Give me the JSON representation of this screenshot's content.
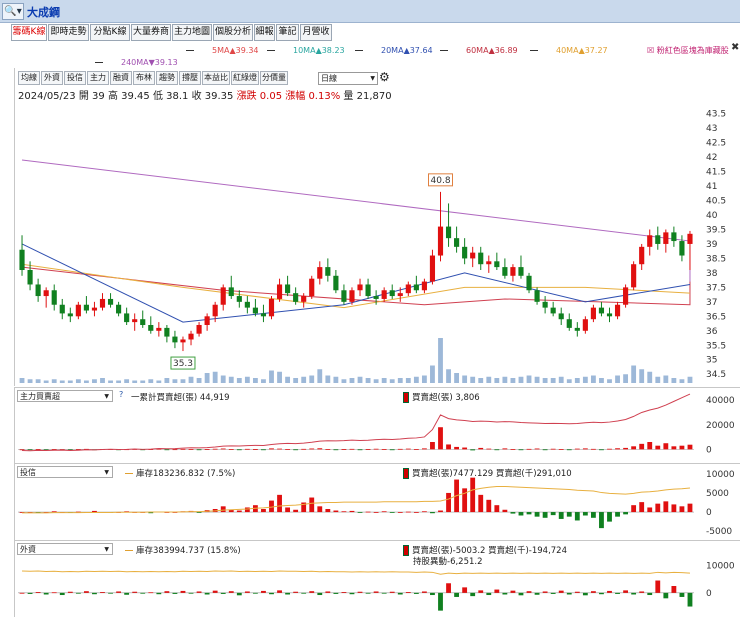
{
  "window": {
    "title": "大成鋼",
    "tool_icon": "magnifier-icon"
  },
  "tabs": [
    "籌碼K線",
    "即時走勢",
    "分點K線",
    "大量券商",
    "主力地圖",
    "個股分析",
    "細報",
    "筆記",
    "月營收"
  ],
  "active_tab": 0,
  "ma_legend": [
    {
      "label": "5MA",
      "value": "▲39.34",
      "color": "#e04848"
    },
    {
      "label": "10MA",
      "value": "▲38.23",
      "color": "#2aa6a0"
    },
    {
      "label": "20MA",
      "value": "▲37.64",
      "color": "#3050b0"
    },
    {
      "label": "60MA",
      "value": "▲36.89",
      "color": "#c03040"
    },
    {
      "label": "40MA",
      "value": "▲37.27",
      "color": "#e0a030"
    },
    {
      "label": "240MA",
      "value": "▼39.13",
      "color": "#a050b0"
    }
  ],
  "note": "粉紅色區塊為庫藏股",
  "toolbar": [
    "均線",
    "外資",
    "投信",
    "主力",
    "融資",
    "布林",
    "趨勢",
    "撐壓",
    "本益比",
    "紅綠燈",
    "分價量"
  ],
  "period": "日線",
  "info": {
    "date": "2024/05/23",
    "open_label": "開",
    "open": "39",
    "high_label": "高",
    "high": "39.45",
    "low_label": "低",
    "low": "38.1",
    "close_label": "收",
    "close": "39.35",
    "change_label": "漲跌",
    "change": "0.05",
    "pct_label": "漲幅",
    "pct": "0.13%",
    "vol_label": "量",
    "vol": "21,870"
  },
  "price_axis": [
    "43.5",
    "43",
    "42.5",
    "42",
    "41.5",
    "41",
    "40.5",
    "40",
    "39.5",
    "39",
    "38.5",
    "38",
    "37.5",
    "37",
    "36.5",
    "36",
    "35.5",
    "35",
    "34.5"
  ],
  "price_marks": {
    "high": "40.8",
    "low": "35.3"
  },
  "panels": [
    {
      "select": "主力買賣超",
      "legend1": "一累計買賣超(張) 44,919",
      "legend2": "買賣超(張) 3,806",
      "axis": [
        "40000",
        "20000",
        "0"
      ]
    },
    {
      "select": "投信",
      "legend1": "庫存183236.832 (7.5%)",
      "legend2": "買賣超(張)7477.129 買賣超(千)291,010",
      "axis": [
        "10000",
        "5000",
        "0",
        "-5000"
      ]
    },
    {
      "select": "外資",
      "legend1": "庫存383994.737 (15.8%)",
      "legend2": "買賣超(張)-5003.2 買賣超(千)-194,724",
      "legend3": "持股異動-6,251.2",
      "axis": [
        "10000",
        "0"
      ]
    }
  ],
  "chart_data": {
    "type": "candlestick",
    "price_range": [
      34.3,
      43.8
    ],
    "candles": [
      [
        38.8,
        39.3,
        37.9,
        38.1
      ],
      [
        38.1,
        38.4,
        37.4,
        37.6
      ],
      [
        37.6,
        37.8,
        37.0,
        37.2
      ],
      [
        37.2,
        37.5,
        36.8,
        37.4
      ],
      [
        37.4,
        37.6,
        36.7,
        36.9
      ],
      [
        36.9,
        37.1,
        36.4,
        36.6
      ],
      [
        36.6,
        36.8,
        36.3,
        36.5
      ],
      [
        36.5,
        37.0,
        36.4,
        36.9
      ],
      [
        36.9,
        37.2,
        36.6,
        36.7
      ],
      [
        36.7,
        37.0,
        36.5,
        36.8
      ],
      [
        36.8,
        37.3,
        36.7,
        37.1
      ],
      [
        37.1,
        37.3,
        36.8,
        36.9
      ],
      [
        36.9,
        37.0,
        36.5,
        36.6
      ],
      [
        36.6,
        36.8,
        36.2,
        36.3
      ],
      [
        36.3,
        36.6,
        36.0,
        36.4
      ],
      [
        36.4,
        36.7,
        36.1,
        36.2
      ],
      [
        36.2,
        36.5,
        35.9,
        36.0
      ],
      [
        36.0,
        36.3,
        35.8,
        36.1
      ],
      [
        36.1,
        36.2,
        35.6,
        35.8
      ],
      [
        35.8,
        36.0,
        35.4,
        35.6
      ],
      [
        35.6,
        35.8,
        35.3,
        35.7
      ],
      [
        35.7,
        36.0,
        35.5,
        35.9
      ],
      [
        35.9,
        36.3,
        35.8,
        36.2
      ],
      [
        36.2,
        36.6,
        36.0,
        36.5
      ],
      [
        36.5,
        37.0,
        36.3,
        36.9
      ],
      [
        36.9,
        37.6,
        36.7,
        37.5
      ],
      [
        37.5,
        37.9,
        37.1,
        37.2
      ],
      [
        37.2,
        37.4,
        36.8,
        37.0
      ],
      [
        37.0,
        37.2,
        36.6,
        36.8
      ],
      [
        36.8,
        37.1,
        36.5,
        36.6
      ],
      [
        36.6,
        36.9,
        36.3,
        36.5
      ],
      [
        36.5,
        37.2,
        36.4,
        37.1
      ],
      [
        37.1,
        37.8,
        37.0,
        37.6
      ],
      [
        37.6,
        37.9,
        37.2,
        37.3
      ],
      [
        37.3,
        37.5,
        36.9,
        37.0
      ],
      [
        37.0,
        37.3,
        36.8,
        37.2
      ],
      [
        37.2,
        37.9,
        37.1,
        37.8
      ],
      [
        37.8,
        38.4,
        37.6,
        38.2
      ],
      [
        38.2,
        38.5,
        37.7,
        37.9
      ],
      [
        37.9,
        38.1,
        37.3,
        37.4
      ],
      [
        37.4,
        37.6,
        36.9,
        37.0
      ],
      [
        37.0,
        37.5,
        36.9,
        37.4
      ],
      [
        37.4,
        37.8,
        37.2,
        37.6
      ],
      [
        37.6,
        37.8,
        37.1,
        37.2
      ],
      [
        37.2,
        37.4,
        36.9,
        37.1
      ],
      [
        37.1,
        37.5,
        37.0,
        37.4
      ],
      [
        37.4,
        37.6,
        37.1,
        37.2
      ],
      [
        37.2,
        37.5,
        37.0,
        37.3
      ],
      [
        37.3,
        37.7,
        37.2,
        37.6
      ],
      [
        37.6,
        37.9,
        37.3,
        37.4
      ],
      [
        37.4,
        37.8,
        37.3,
        37.7
      ],
      [
        37.7,
        38.8,
        37.6,
        38.6
      ],
      [
        38.6,
        40.8,
        38.4,
        39.6
      ],
      [
        39.6,
        40.4,
        38.9,
        39.2
      ],
      [
        39.2,
        39.6,
        38.7,
        38.9
      ],
      [
        38.9,
        39.2,
        38.3,
        38.5
      ],
      [
        38.5,
        38.9,
        38.2,
        38.7
      ],
      [
        38.7,
        38.9,
        38.1,
        38.3
      ],
      [
        38.3,
        38.6,
        38.0,
        38.4
      ],
      [
        38.4,
        38.7,
        38.1,
        38.2
      ],
      [
        38.2,
        38.5,
        37.8,
        37.9
      ],
      [
        37.9,
        38.3,
        37.7,
        38.2
      ],
      [
        38.2,
        38.6,
        37.8,
        37.9
      ],
      [
        37.9,
        38.0,
        37.3,
        37.4
      ],
      [
        37.4,
        37.5,
        36.9,
        37.0
      ],
      [
        37.0,
        37.2,
        36.6,
        36.8
      ],
      [
        36.8,
        37.0,
        36.5,
        36.6
      ],
      [
        36.6,
        36.8,
        36.2,
        36.4
      ],
      [
        36.4,
        36.6,
        36.0,
        36.1
      ],
      [
        36.1,
        36.3,
        35.8,
        36.0
      ],
      [
        36.0,
        36.5,
        35.9,
        36.4
      ],
      [
        36.4,
        36.9,
        36.3,
        36.8
      ],
      [
        36.8,
        37.0,
        36.5,
        36.6
      ],
      [
        36.6,
        36.8,
        36.3,
        36.5
      ],
      [
        36.5,
        37.0,
        36.4,
        36.9
      ],
      [
        36.9,
        37.6,
        36.8,
        37.5
      ],
      [
        37.5,
        38.4,
        37.4,
        38.3
      ],
      [
        38.3,
        39.0,
        38.1,
        38.9
      ],
      [
        38.9,
        39.5,
        38.6,
        39.3
      ],
      [
        39.3,
        39.6,
        38.8,
        39.0
      ],
      [
        39.0,
        39.5,
        38.7,
        39.4
      ],
      [
        39.4,
        39.6,
        38.9,
        39.1
      ],
      [
        39.1,
        39.3,
        38.4,
        38.6
      ],
      [
        39,
        39.45,
        38.1,
        39.35
      ]
    ],
    "volumes": [
      4,
      3,
      3,
      2,
      3,
      2,
      2,
      3,
      2,
      3,
      4,
      2,
      2,
      3,
      2,
      2,
      3,
      2,
      4,
      3,
      3,
      5,
      4,
      8,
      9,
      6,
      5,
      4,
      5,
      4,
      3,
      10,
      9,
      5,
      4,
      5,
      6,
      11,
      6,
      5,
      3,
      4,
      5,
      4,
      3,
      4,
      3,
      4,
      4,
      5,
      6,
      14,
      36,
      11,
      8,
      6,
      5,
      4,
      5,
      4,
      5,
      4,
      5,
      6,
      5,
      4,
      4,
      5,
      3,
      4,
      5,
      6,
      4,
      3,
      6,
      7,
      14,
      11,
      9,
      5,
      6,
      4,
      3,
      5
    ],
    "ma_lines": {
      "ma240": [
        {
          "i": 0,
          "v": 41.9
        },
        {
          "i": 83,
          "v": 39.1
        },
        {
          "i": 95,
          "v": 37.4
        }
      ],
      "ma60": [
        {
          "i": 0,
          "v": 38.2
        },
        {
          "i": 25,
          "v": 37.4
        },
        {
          "i": 50,
          "v": 36.9
        },
        {
          "i": 60,
          "v": 37.1
        },
        {
          "i": 83,
          "v": 36.9
        },
        {
          "i": 95,
          "v": 37.7
        }
      ],
      "ma40": [
        {
          "i": 0,
          "v": 38.3
        },
        {
          "i": 20,
          "v": 37.5
        },
        {
          "i": 40,
          "v": 36.8
        },
        {
          "i": 55,
          "v": 37.5
        },
        {
          "i": 70,
          "v": 37.5
        },
        {
          "i": 83,
          "v": 37.3
        }
      ],
      "ma20": [
        {
          "i": 0,
          "v": 39.0
        },
        {
          "i": 20,
          "v": 36.3
        },
        {
          "i": 40,
          "v": 36.9
        },
        {
          "i": 55,
          "v": 38.0
        },
        {
          "i": 70,
          "v": 37.0
        },
        {
          "i": 83,
          "v": 37.6
        }
      ]
    },
    "main_net": [
      0,
      -200,
      300,
      -100,
      200,
      100,
      -300,
      200,
      400,
      -100,
      300,
      200,
      -200,
      100,
      300,
      -300,
      200,
      500,
      -200,
      100,
      400,
      300,
      -100,
      200,
      500,
      700,
      300,
      -200,
      400,
      200,
      -100,
      800,
      600,
      300,
      -200,
      400,
      700,
      900,
      300,
      -100,
      200,
      400,
      -300,
      200,
      500,
      300,
      -200,
      400,
      600,
      300,
      800,
      6000,
      18000,
      4000,
      2000,
      1500,
      -800,
      1200,
      600,
      -500,
      800,
      300,
      -600,
      400,
      700,
      -300,
      500,
      300,
      -200,
      600,
      800,
      400,
      -300,
      500,
      900,
      1200,
      2500,
      4500,
      6000,
      3000,
      5000,
      2500,
      3000,
      3806
    ],
    "main_cum": [
      -900,
      -1100,
      -800,
      -900,
      -700,
      -600,
      -900,
      -700,
      -300,
      -400,
      -100,
      100,
      -100,
      0,
      300,
      0,
      200,
      700,
      500,
      600,
      1000,
      1300,
      1200,
      1400,
      1900,
      2600,
      2900,
      2700,
      3100,
      3300,
      3200,
      4000,
      4600,
      4900,
      4700,
      5100,
      5800,
      6700,
      7000,
      6900,
      7100,
      7500,
      7200,
      7400,
      7900,
      8200,
      8000,
      8400,
      9000,
      9300,
      10100,
      16100,
      28000,
      25000,
      24000,
      23500,
      22700,
      23000,
      22800,
      22300,
      22600,
      22400,
      21800,
      21500,
      21300,
      21000,
      21100,
      21000,
      20800,
      21000,
      21600,
      22000,
      21700,
      22200,
      23100,
      24300,
      26800,
      30000,
      32000,
      33500,
      36000,
      39000,
      42000,
      44919
    ],
    "trust_net": [
      0,
      0,
      -100,
      0,
      200,
      0,
      -200,
      100,
      0,
      300,
      0,
      -100,
      0,
      200,
      0,
      0,
      -300,
      100,
      0,
      0,
      200,
      300,
      -100,
      500,
      800,
      1500,
      600,
      400,
      1200,
      1800,
      800,
      3000,
      4500,
      1200,
      600,
      2500,
      3800,
      1500,
      800,
      400,
      200,
      300,
      -200,
      100,
      0,
      200,
      -100,
      0,
      100,
      0,
      200,
      -300,
      400,
      5000,
      8500,
      6200,
      9000,
      4500,
      3200,
      1800,
      600,
      -400,
      -900,
      -600,
      -1200,
      -1500,
      -800,
      -1800,
      -1200,
      -2200,
      -900,
      -1500,
      -4200,
      -2500,
      -1200,
      -600,
      1800,
      2600,
      1200,
      2200,
      2800,
      2000,
      1500,
      2200
    ],
    "trust_inv": [
      -200,
      -200,
      -200,
      -200,
      -150,
      -150,
      -150,
      -150,
      -100,
      -100,
      -100,
      -100,
      -50,
      -50,
      -50,
      -50,
      0,
      0,
      0,
      0,
      50,
      100,
      100,
      200,
      300,
      500,
      600,
      700,
      800,
      1000,
      1100,
      1300,
      1600,
      1700,
      1800,
      2000,
      2300,
      2400,
      2500,
      2500,
      2600,
      2600,
      2600,
      2600,
      2600,
      2700,
      2700,
      2700,
      2700,
      2700,
      2800,
      2800,
      2900,
      3400,
      4300,
      4900,
      5800,
      6200,
      6500,
      6700,
      6700,
      6600,
      6500,
      6400,
      6300,
      6200,
      6100,
      6000,
      5900,
      5700,
      5600,
      5500,
      5100,
      4900,
      4800,
      4700,
      4900,
      5200,
      5300,
      5500,
      5800,
      6000,
      6100,
      6300
    ],
    "foreign_net": [
      0,
      -400,
      300,
      -600,
      200,
      -800,
      400,
      -300,
      600,
      -500,
      300,
      -200,
      500,
      -700,
      400,
      -300,
      200,
      -500,
      600,
      -400,
      700,
      -300,
      500,
      -600,
      800,
      -400,
      600,
      -900,
      500,
      -300,
      700,
      -500,
      900,
      -600,
      400,
      -300,
      600,
      -800,
      500,
      -400,
      300,
      -500,
      400,
      -300,
      500,
      -200,
      400,
      -600,
      300,
      -400,
      500,
      -800,
      -6500,
      3500,
      -1500,
      2000,
      -1200,
      900,
      -800,
      1200,
      -600,
      800,
      -900,
      600,
      -700,
      500,
      -400,
      800,
      -600,
      400,
      -900,
      600,
      -500,
      700,
      -400,
      900,
      -600,
      500,
      -800,
      4500,
      -2000,
      2500,
      -1500,
      -5003
    ],
    "foreign_inv": [
      8000,
      7900,
      8000,
      7800,
      7900,
      7700,
      7800,
      7700,
      7900,
      7800,
      7900,
      7800,
      7900,
      7700,
      7800,
      7700,
      7800,
      7700,
      7800,
      7700,
      7900,
      7800,
      7900,
      7800,
      8000,
      7900,
      8000,
      7800,
      7900,
      7800,
      7900,
      7800,
      8000,
      7900,
      7900,
      7800,
      7900,
      7700,
      7800,
      7700,
      7700,
      7600,
      7700,
      7600,
      7700,
      7600,
      7700,
      7600,
      7600,
      7500,
      7600,
      7500,
      6800,
      7200,
      7000,
      7200,
      7100,
      7200,
      7100,
      7200,
      7100,
      7200,
      7100,
      7200,
      7100,
      7200,
      7100,
      7200,
      7100,
      7200,
      7100,
      7200,
      7100,
      7200,
      7100,
      7200,
      7100,
      7200,
      7100,
      7500,
      7300,
      7500,
      7400,
      7200
    ]
  }
}
